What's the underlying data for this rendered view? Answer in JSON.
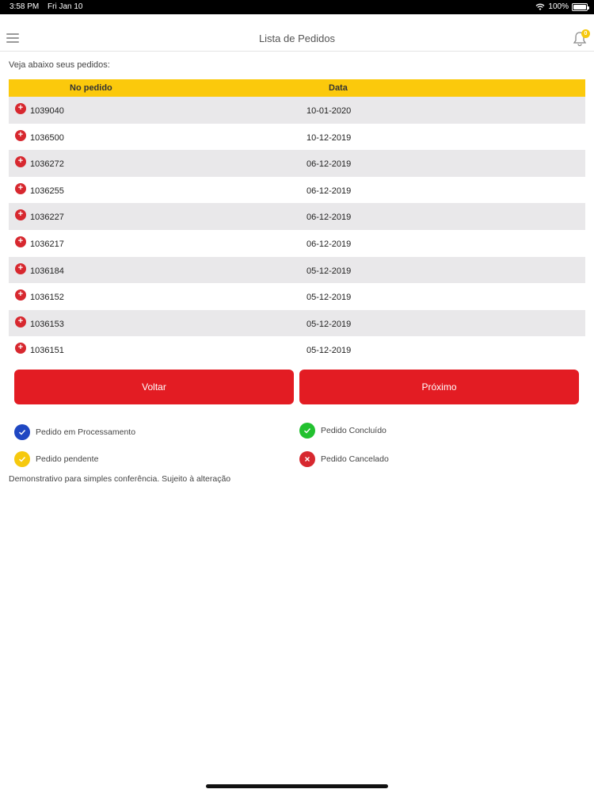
{
  "status_bar": {
    "time": "3:58 PM",
    "date": "Fri Jan 10",
    "battery": "100%"
  },
  "navbar": {
    "title": "Lista de Pedidos",
    "notification_count": "0"
  },
  "intro": "Veja abaixo seus pedidos:",
  "table": {
    "headers": {
      "number": "No pedido",
      "date": "Data"
    },
    "rows": [
      {
        "number": "1039040",
        "date": "10-01-2020"
      },
      {
        "number": "1036500",
        "date": "10-12-2019"
      },
      {
        "number": "1036272",
        "date": "06-12-2019"
      },
      {
        "number": "1036255",
        "date": "06-12-2019"
      },
      {
        "number": "1036227",
        "date": "06-12-2019"
      },
      {
        "number": "1036217",
        "date": "06-12-2019"
      },
      {
        "number": "1036184",
        "date": "05-12-2019"
      },
      {
        "number": "1036152",
        "date": "05-12-2019"
      },
      {
        "number": "1036153",
        "date": "05-12-2019"
      },
      {
        "number": "1036151",
        "date": "05-12-2019"
      }
    ]
  },
  "buttons": {
    "back": "Voltar",
    "next": "Próximo"
  },
  "legend": {
    "processing": "Pedido em Processamento",
    "completed": "Pedido Concluído",
    "pending": "Pedido pendente",
    "cancelled": "Pedido Cancelado"
  },
  "disclaimer": "Demonstrativo para simples conferência. Sujeito à alteração",
  "colors": {
    "header_yellow": "#fbc90c",
    "button_red": "#e31c23",
    "status_blue": "#1f47c2",
    "status_green": "#22c12f",
    "status_yellow": "#f6c90e",
    "status_red": "#d7282f"
  },
  "icons": {
    "menu": "hamburger-icon",
    "notifications": "bell-icon",
    "row_expand": "plus-circle-icon",
    "processing": "check-icon",
    "completed": "check-icon",
    "pending": "check-icon",
    "cancelled": "x-icon"
  }
}
